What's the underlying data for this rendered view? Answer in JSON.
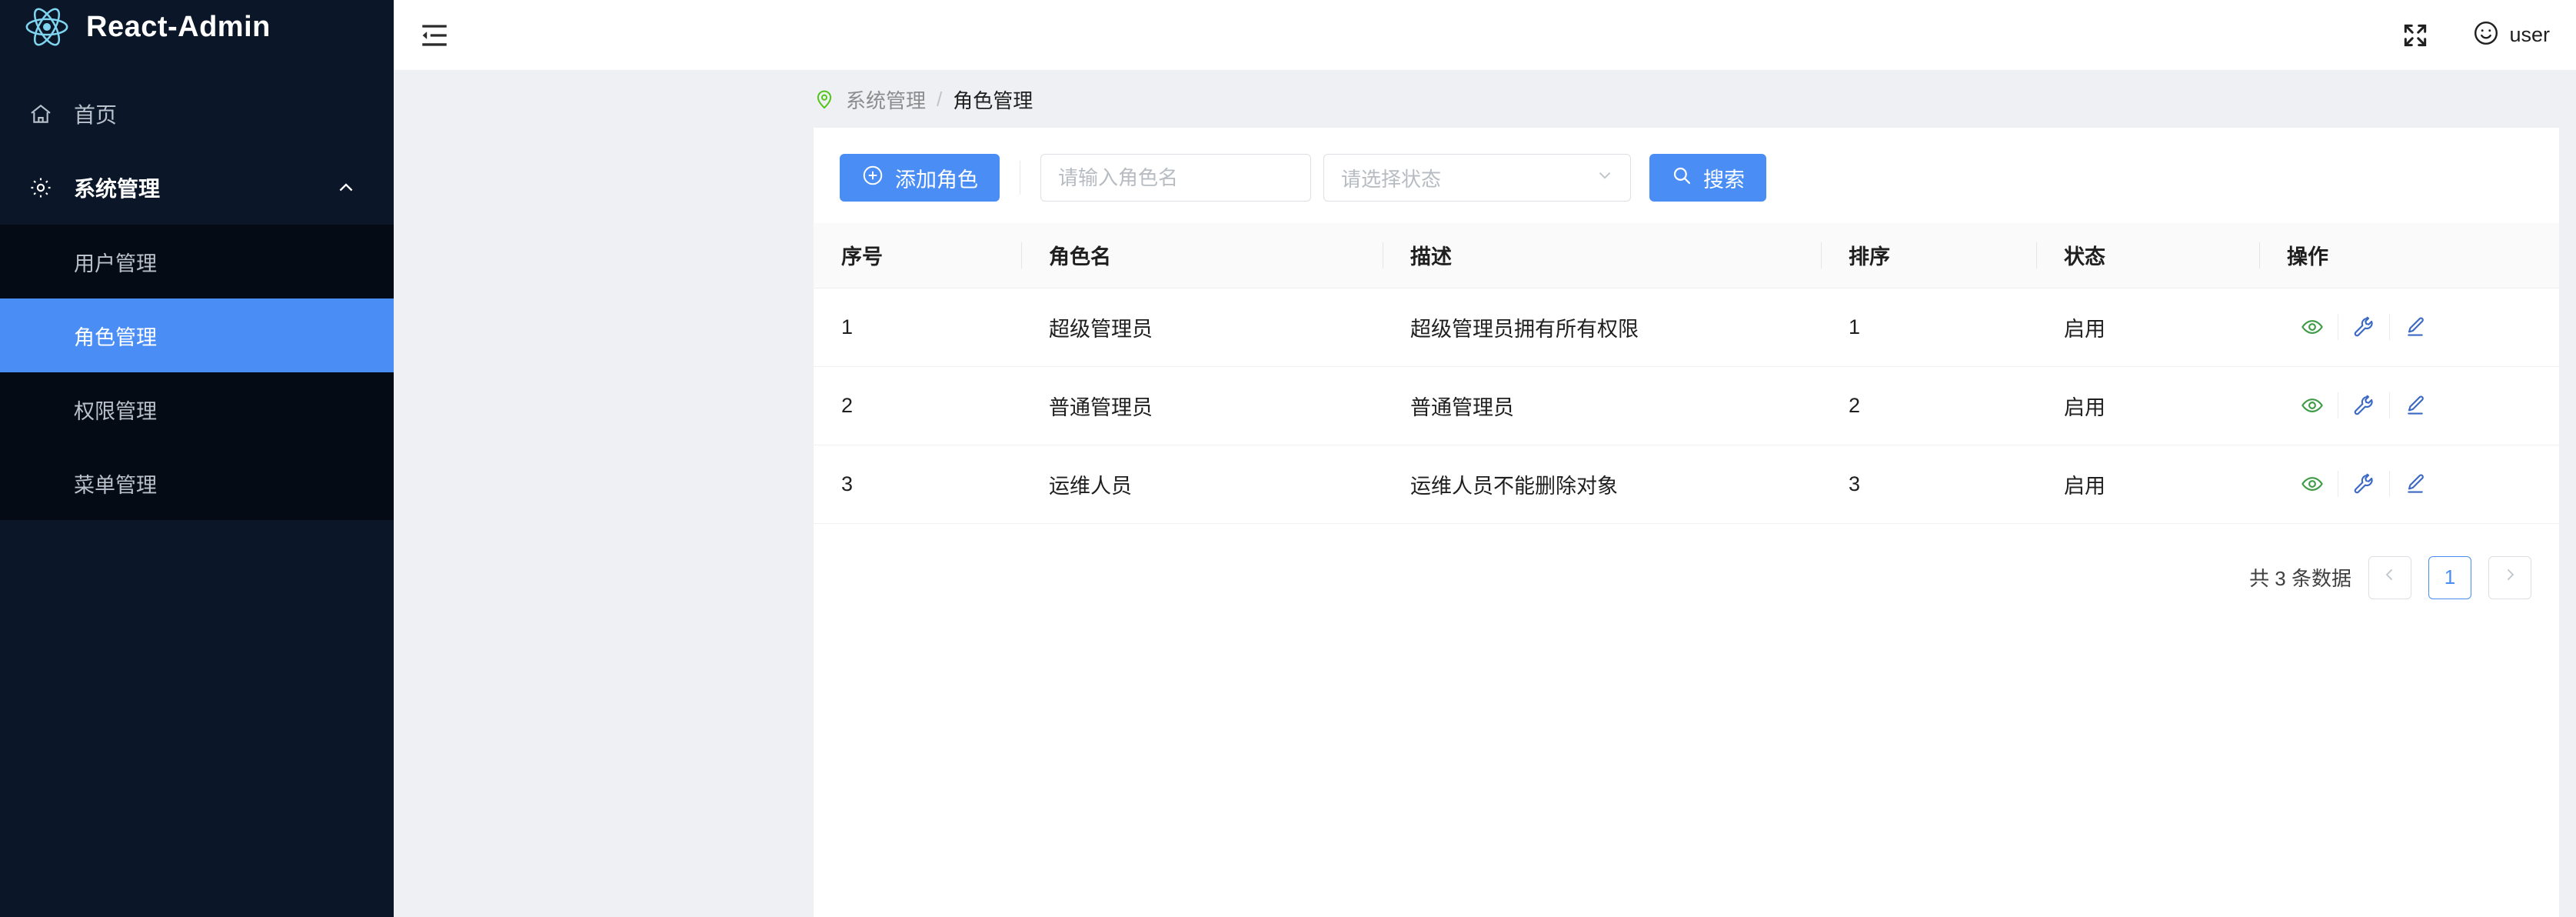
{
  "brand": {
    "title": "React-Admin",
    "logo_icon": "react-atom-icon"
  },
  "sidebar": {
    "home": {
      "label": "首页",
      "icon": "home-icon"
    },
    "group": {
      "label": "系统管理",
      "icon": "gear-icon",
      "caret_icon": "chevron-up-icon"
    },
    "submenu": [
      {
        "label": "用户管理",
        "active": false
      },
      {
        "label": "角色管理",
        "active": true
      },
      {
        "label": "权限管理",
        "active": false
      },
      {
        "label": "菜单管理",
        "active": false
      }
    ]
  },
  "topbar": {
    "collapse_icon": "menu-fold-icon",
    "fullscreen_icon": "fullscreen-expand-icon",
    "avatar_icon": "smiley-face-icon",
    "user_name": "user"
  },
  "breadcrumb": {
    "pin_icon": "location-pin-icon",
    "parent": "系统管理",
    "separator": "/",
    "current": "角色管理"
  },
  "toolbar": {
    "add_button": {
      "label": "添加角色",
      "icon": "plus-circle-icon"
    },
    "name_input": {
      "value": "",
      "placeholder": "请输入角色名"
    },
    "status_select": {
      "value": "",
      "placeholder": "请选择状态",
      "icon": "chevron-down-icon"
    },
    "search_button": {
      "label": "搜索",
      "icon": "search-icon"
    }
  },
  "table": {
    "columns": [
      "序号",
      "角色名",
      "描述",
      "排序",
      "状态",
      "操作"
    ],
    "rows": [
      {
        "index": "1",
        "name": "超级管理员",
        "desc": "超级管理员拥有所有权限",
        "sort": "1",
        "status": "启用"
      },
      {
        "index": "2",
        "name": "普通管理员",
        "desc": "普通管理员",
        "sort": "2",
        "status": "启用"
      },
      {
        "index": "3",
        "name": "运维人员",
        "desc": "运维人员不能删除对象",
        "sort": "3",
        "status": "启用"
      }
    ],
    "ops": [
      {
        "name": "view",
        "icon": "eye-icon"
      },
      {
        "name": "permission",
        "icon": "wrench-icon"
      },
      {
        "name": "edit",
        "icon": "pencil-icon"
      }
    ]
  },
  "pagination": {
    "total_text": "共 3 条数据",
    "prev_icon": "chevron-left-icon",
    "current_page": "1",
    "next_icon": "chevron-right-icon"
  },
  "colors": {
    "sidebar_bg": "#0b1728",
    "submenu_bg": "#040b14",
    "accent": "#4a8ef5",
    "status_green": "#3f9b46",
    "page_bg": "#eef0f4",
    "logo_blue": "#7fd4f0"
  }
}
